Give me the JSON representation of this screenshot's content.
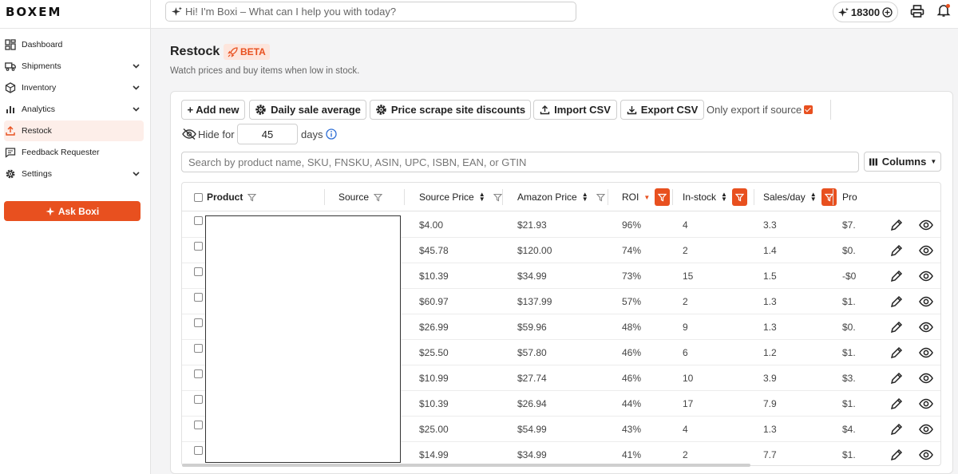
{
  "app": {
    "logo": "BOXEM"
  },
  "sidebar": {
    "items": [
      {
        "label": "Dashboard",
        "icon": "dashboard-icon",
        "has_chevron": false,
        "active": false
      },
      {
        "label": "Shipments",
        "icon": "truck-icon",
        "has_chevron": true,
        "active": false
      },
      {
        "label": "Inventory",
        "icon": "box-icon",
        "has_chevron": true,
        "active": false
      },
      {
        "label": "Analytics",
        "icon": "bar-chart-icon",
        "has_chevron": true,
        "active": false
      },
      {
        "label": "Restock",
        "icon": "restock-icon",
        "has_chevron": false,
        "active": true
      },
      {
        "label": "Feedback Requester",
        "icon": "message-icon",
        "has_chevron": false,
        "active": false
      },
      {
        "label": "Settings",
        "icon": "gear-icon",
        "has_chevron": true,
        "active": false
      }
    ],
    "ask_label": "Ask Boxi"
  },
  "topbar": {
    "boxi_placeholder": "Hi! I'm Boxi – What can I help you with today?",
    "credits": "18300"
  },
  "page": {
    "title": "Restock",
    "badge": "BETA",
    "subtitle": "Watch prices and buy items when low in stock."
  },
  "toolbar": {
    "add_new": "+ Add new",
    "daily_sale": "Daily sale average",
    "price_scrape": "Price scrape site discounts",
    "import_csv": "Import CSV",
    "export_csv": "Export CSV",
    "only_export": "Only export if source",
    "hide_for": "Hide for",
    "hide_days_value": "45",
    "days": "days",
    "search_placeholder": "Search by product name, SKU, FNSKU, ASIN, UPC, ISBN, EAN, or GTIN",
    "columns": "Columns"
  },
  "table": {
    "headers": {
      "product": "Product",
      "source": "Source",
      "source_price": "Source Price",
      "amazon_price": "Amazon Price",
      "roi": "ROI",
      "in_stock": "In-stock",
      "sales_day": "Sales/day",
      "profit": "Pro"
    },
    "rows": [
      {
        "source_price": "$4.00",
        "amazon_price": "$21.93",
        "roi": "96%",
        "in_stock": "4",
        "sales_day": "3.3",
        "profit": "$7."
      },
      {
        "source_price": "$45.78",
        "amazon_price": "$120.00",
        "roi": "74%",
        "in_stock": "2",
        "sales_day": "1.4",
        "profit": "$0."
      },
      {
        "source_price": "$10.39",
        "amazon_price": "$34.99",
        "roi": "73%",
        "in_stock": "15",
        "sales_day": "1.5",
        "profit": "-$0"
      },
      {
        "source_price": "$60.97",
        "amazon_price": "$137.99",
        "roi": "57%",
        "in_stock": "2",
        "sales_day": "1.3",
        "profit": "$1."
      },
      {
        "source_price": "$26.99",
        "amazon_price": "$59.96",
        "roi": "48%",
        "in_stock": "9",
        "sales_day": "1.3",
        "profit": "$0."
      },
      {
        "source_price": "$25.50",
        "amazon_price": "$57.80",
        "roi": "46%",
        "in_stock": "6",
        "sales_day": "1.2",
        "profit": "$1."
      },
      {
        "source_price": "$10.99",
        "amazon_price": "$27.74",
        "roi": "46%",
        "in_stock": "10",
        "sales_day": "3.9",
        "profit": "$3."
      },
      {
        "source_price": "$10.39",
        "amazon_price": "$26.94",
        "roi": "44%",
        "in_stock": "17",
        "sales_day": "7.9",
        "profit": "$1."
      },
      {
        "source_price": "$25.00",
        "amazon_price": "$54.99",
        "roi": "43%",
        "in_stock": "4",
        "sales_day": "1.3",
        "profit": "$4."
      },
      {
        "source_price": "$14.99",
        "amazon_price": "$34.99",
        "roi": "41%",
        "in_stock": "2",
        "sales_day": "7.7",
        "profit": "$1."
      }
    ]
  },
  "colors": {
    "accent": "#e8501f",
    "accent_light": "#fdeee9"
  }
}
